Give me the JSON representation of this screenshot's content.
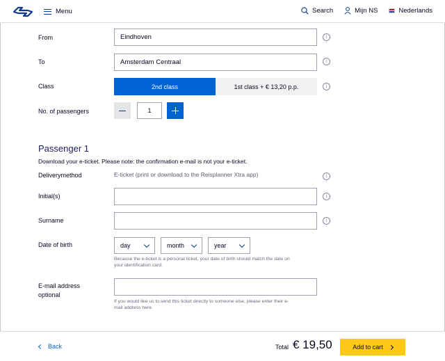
{
  "colors": {
    "primary": "#0063d3",
    "accent": "#ffc917",
    "text": "#070721"
  },
  "header": {
    "menu_label": "Menu",
    "search_label": "Search",
    "account_label": "Mijn NS",
    "language_label": "Nederlands"
  },
  "journey": {
    "from_label": "From",
    "from_value": "Eindhoven",
    "to_label": "To",
    "to_value": "Amsterdam Centraal",
    "class_label": "Class",
    "class_options": [
      "2nd class",
      "1st class + € 13,20 p.p."
    ],
    "selected_class": "2nd class",
    "passengers_label": "No. of passengers",
    "passengers_value": "1"
  },
  "passenger": {
    "title": "Passenger 1",
    "notice": "Download your e-ticket. Please note: the confirmation e-mail is not your e-ticket.",
    "delivery_label": "Deliverymethod",
    "delivery_value": "E-ticket (print or download to the Reisplanner Xtra app)",
    "initials_label": "Initial(s)",
    "initials_value": "",
    "surname_label": "Surname",
    "surname_value": "",
    "dob_label": "Date of birth",
    "dob_day": "day",
    "dob_month": "month",
    "dob_year": "year",
    "dob_hint_line1": "Because the e-ticket is a personal ticket, your date of birth should match the date on",
    "dob_hint_line2": "your identification card.",
    "email_label_line1": "E-mail address",
    "email_label_line2": "optional",
    "email_value": "",
    "email_hint_line1": "If you would like us to send this ticket directly to someone else, please enter their e-",
    "email_hint_line2": "mail address here."
  },
  "footer": {
    "back_label": "Back",
    "total_label": "Total",
    "total_value": "€ 19,50",
    "cart_label": "Add to cart"
  }
}
